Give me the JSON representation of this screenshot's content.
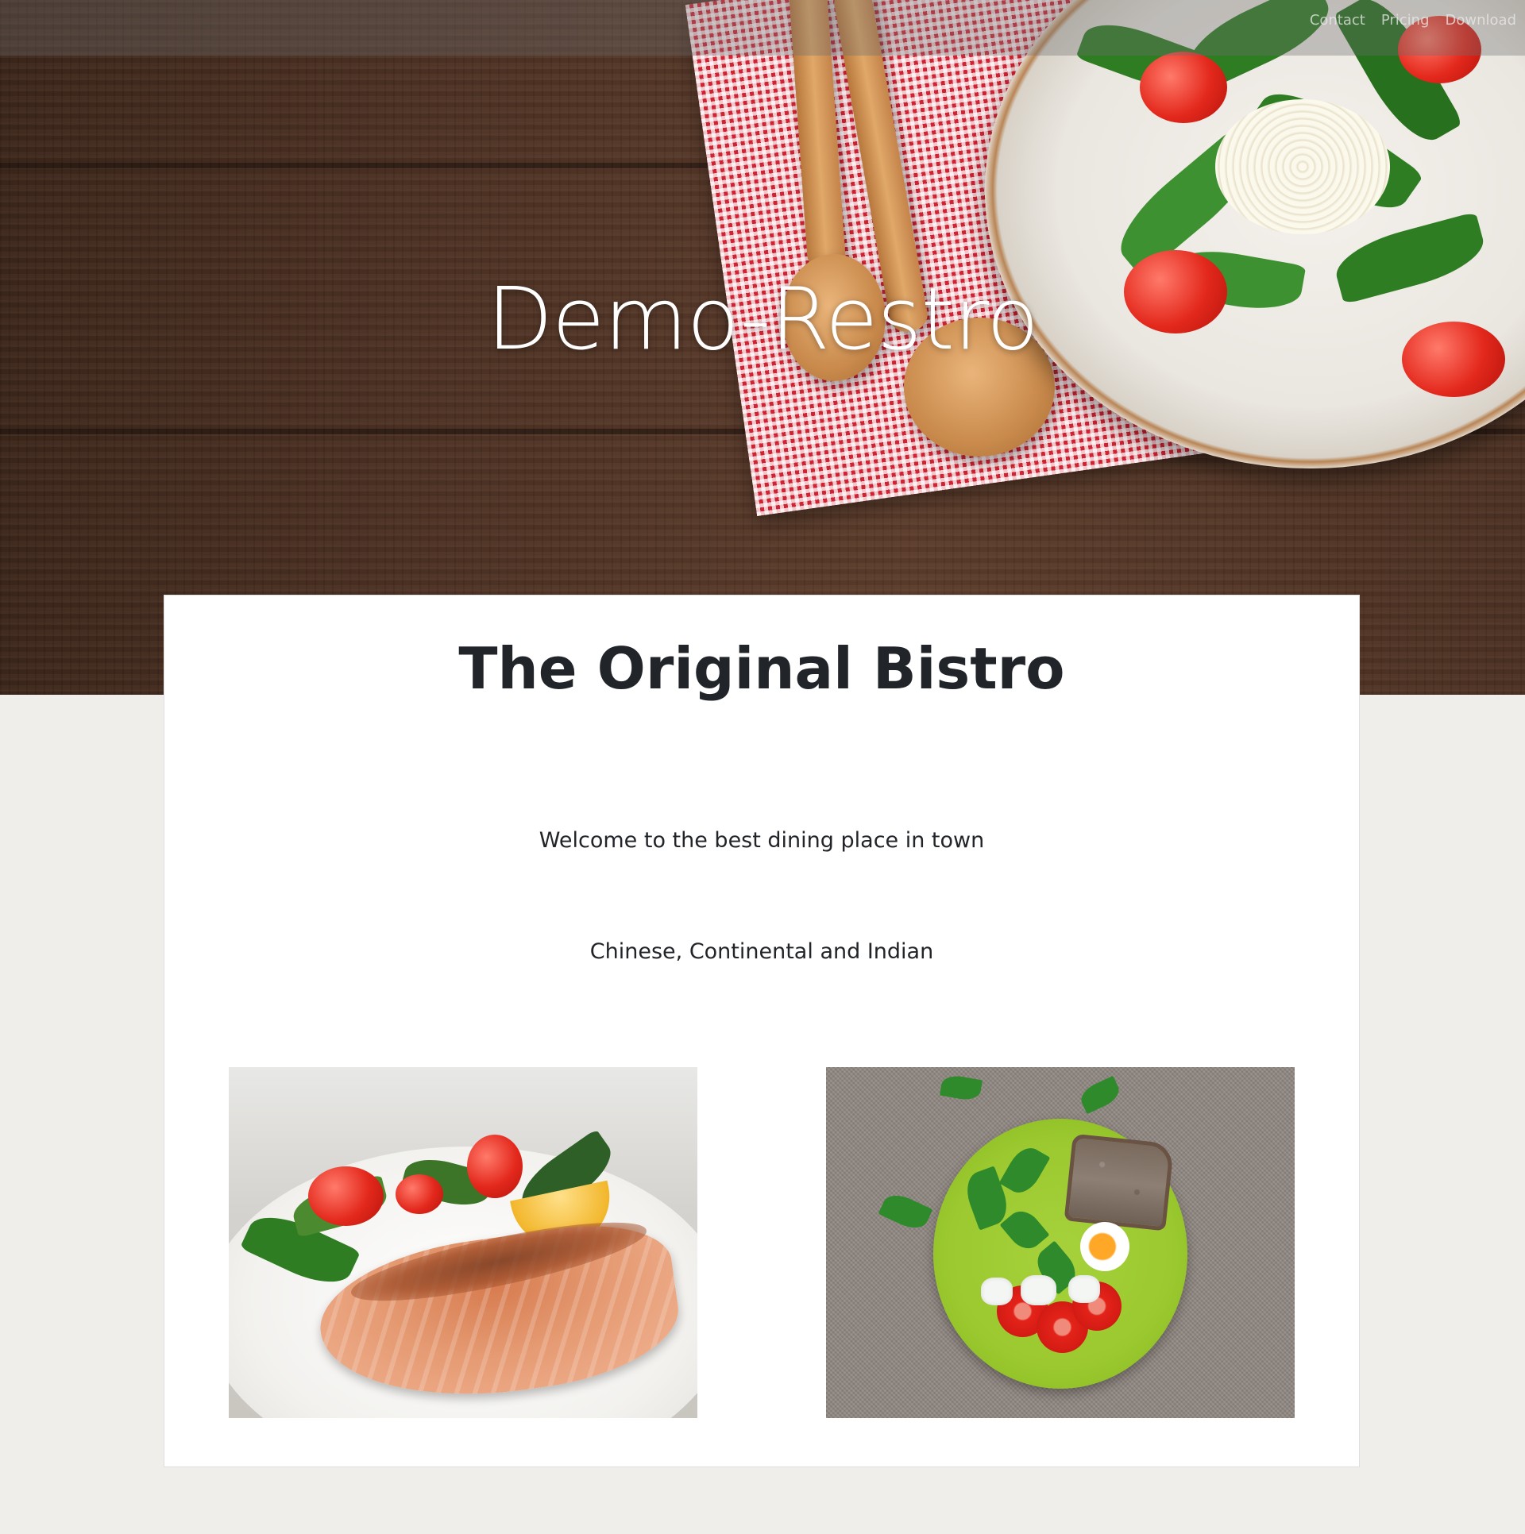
{
  "nav": {
    "links": [
      "Contact",
      "Pricing",
      "Download"
    ]
  },
  "hero": {
    "title": "Demo-Restro"
  },
  "main": {
    "title": "The Original Bistro",
    "tagline": "Welcome to the best dining place in town",
    "cuisines": "Chinese, Continental and Indian"
  },
  "icons": {
    "photo_left": "salmon-salad-photo",
    "photo_right": "green-plate-salad-photo"
  },
  "colors": {
    "page_background": "#efeeea",
    "card_background": "#ffffff",
    "text_dark": "#212529",
    "hero_text": "#ffffff"
  }
}
